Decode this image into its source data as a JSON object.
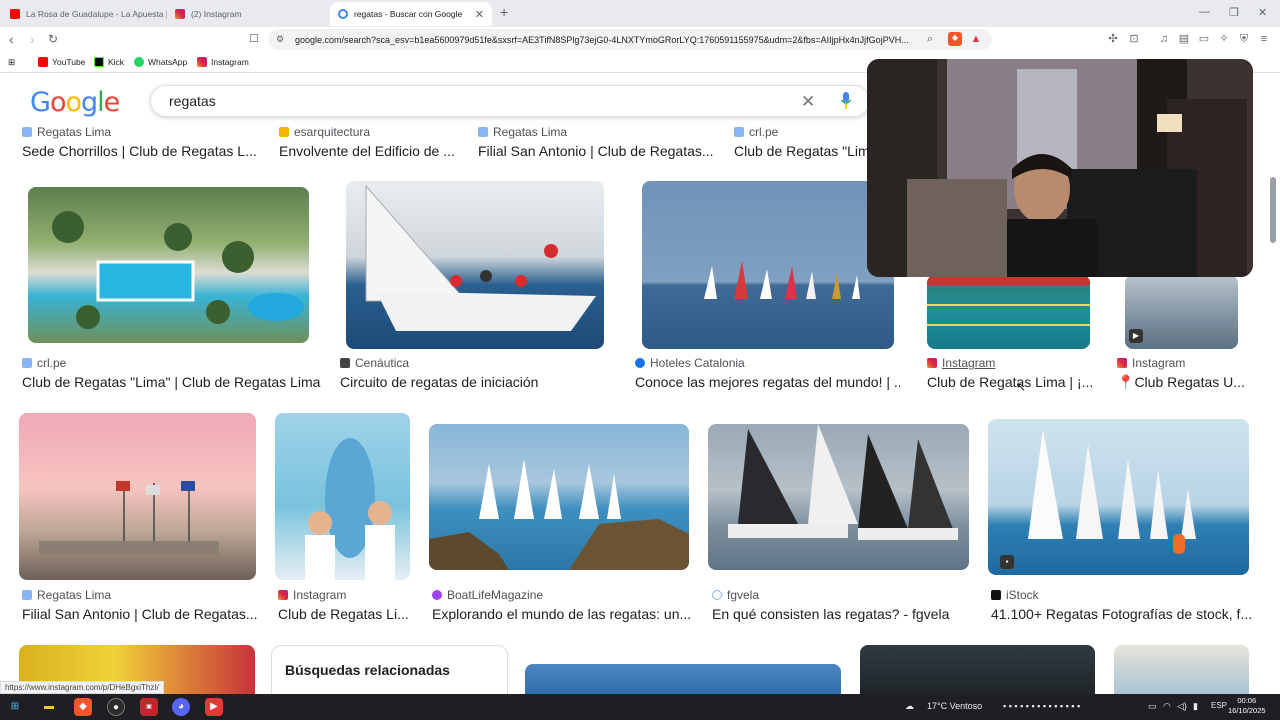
{
  "browser": {
    "tabs": [
      {
        "title": "La Rosa de Guadalupe - La Apuesta |",
        "active": false
      },
      {
        "title": "(2) Instagram",
        "active": false
      },
      {
        "title": "regatas - Buscar con Google",
        "active": true
      }
    ],
    "url": "google.com/search?sca_esv=b1ea5600979d51fe&sxsrf=AE3TifN8SPlg73ejG0-4LNXTYmoGRorLYQ:1760591155975&udm=2&fbs=AIIjpHx4nJjfGojPVH...",
    "bookmarks": [
      "YouTube",
      "Kick",
      "WhatsApp",
      "Instagram"
    ]
  },
  "search": {
    "logo": "Google",
    "query": "regatas"
  },
  "top_row": [
    {
      "source": "Regatas Lima",
      "title": "Sede Chorrillos | Club de Regatas L..."
    },
    {
      "source": "esarquitectura",
      "title": "Envolvente del Edificio de ..."
    },
    {
      "source": "Regatas Lima",
      "title": "Filial San Antonio | Club de Regatas..."
    },
    {
      "source": "crl.pe",
      "title": "Club de Regatas \"Lima\""
    }
  ],
  "row1": [
    {
      "source": "crl.pe",
      "title": "Club de Regatas \"Lima\" | Club de Regatas Lima"
    },
    {
      "source": "Cenáutica",
      "title": "Circuito de regatas de iniciación"
    },
    {
      "source": "Hoteles Catalonia",
      "title": "Conoce las mejores regatas del mundo! | ..."
    },
    {
      "source": "Instagram",
      "title": "Club de Regatas Lima | ¡..."
    },
    {
      "source": "Instagram",
      "title": "Club Regatas U..."
    }
  ],
  "row2": [
    {
      "source": "Regatas Lima",
      "title": "Filial San Antonio | Club de Regatas..."
    },
    {
      "source": "Instagram",
      "title": "Club de Regatas Li..."
    },
    {
      "source": "BoatLifeMagazine",
      "title": "Explorando el mundo de las regatas: un..."
    },
    {
      "source": "fgvela",
      "title": "En qué consisten las regatas? - fgvela"
    },
    {
      "source": "iStock",
      "title": "41.100+ Regatas Fotografías de stock, f..."
    }
  ],
  "related_label": "Búsquedas relacionadas",
  "status_url": "https://www.instagram.com/p/DHeBgxiThzI/",
  "taskbar": {
    "weather": "17°C  Ventoso",
    "lang": "ESP",
    "time": "00:06",
    "date": "16/10/2025"
  },
  "colors": {
    "google_blue": "#4285f4",
    "google_red": "#ea4335",
    "google_yellow": "#fbbc05",
    "google_green": "#34a853"
  }
}
